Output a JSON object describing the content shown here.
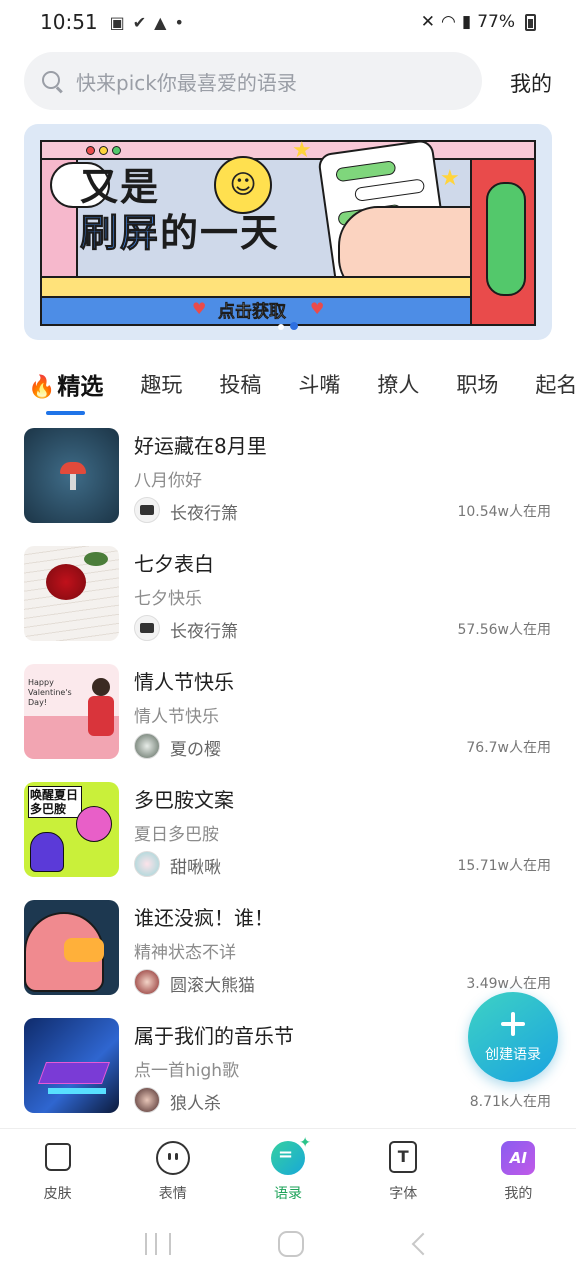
{
  "status_bar": {
    "time": "10:51",
    "battery": "77%"
  },
  "search": {
    "placeholder": "快来pick你最喜爱的语录"
  },
  "header": {
    "mine_label": "我的"
  },
  "banner": {
    "title_line1": "又是",
    "title_line2_blue": "刷屏",
    "title_line2_rest": "的一天",
    "cta": "点击获取",
    "page_count": 2,
    "active_page": 2
  },
  "tabs": [
    {
      "label": "精选",
      "active": true
    },
    {
      "label": "趣玩"
    },
    {
      "label": "投稿"
    },
    {
      "label": "斗嘴"
    },
    {
      "label": "撩人"
    },
    {
      "label": "职场"
    },
    {
      "label": "起名"
    }
  ],
  "list": [
    {
      "title": "好运藏在8月里",
      "subtitle": "八月你好",
      "author": "长夜行箫",
      "users": "10.54w人在用"
    },
    {
      "title": "七夕表白",
      "subtitle": "七夕快乐",
      "author": "长夜行箫",
      "users": "57.56w人在用"
    },
    {
      "title": "情人节快乐",
      "subtitle": "情人节快乐",
      "author": "夏の樱",
      "users": "76.7w人在用",
      "thumb_text": "Happy Valentine's Day!"
    },
    {
      "title": "多巴胺文案",
      "subtitle": "夏日多巴胺",
      "author": "甜啾啾",
      "users": "15.71w人在用",
      "thumb_text": "唤醒夏日多巴胺"
    },
    {
      "title": "谁还没疯！谁！",
      "subtitle": "精神状态不详",
      "author": "圆滚大熊猫",
      "users": "3.49w人在用"
    },
    {
      "title": "属于我们的音乐节",
      "subtitle": "点一首high歌",
      "author": "狼人杀",
      "users": "8.71k人在用"
    }
  ],
  "fab": {
    "label": "创建语录"
  },
  "bottom_nav": [
    {
      "label": "皮肤",
      "icon": "shirt-icon"
    },
    {
      "label": "表情",
      "icon": "face-icon"
    },
    {
      "label": "语录",
      "icon": "quote-icon",
      "active": true
    },
    {
      "label": "字体",
      "icon": "font-icon"
    },
    {
      "label": "我的",
      "icon": "ai-icon",
      "icon_text": "AI"
    }
  ],
  "colors": {
    "accent_blue": "#1f74e8",
    "active_green": "#1ea35a",
    "fab_start": "#3ed2c4",
    "fab_end": "#1aa3e0"
  }
}
